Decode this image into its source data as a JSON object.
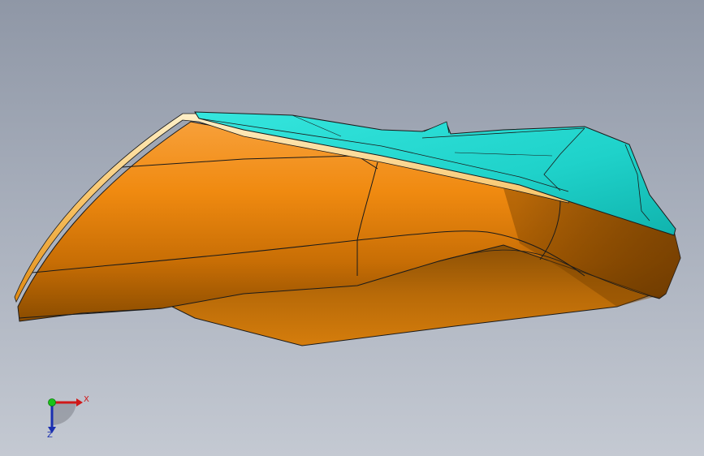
{
  "viewport": {
    "background_top": "#8f97a6",
    "background_bottom": "#c4c9d2"
  },
  "model": {
    "hull_color": "#f08a10",
    "hull_shadow_color": "#7a4300",
    "deck_color": "#1fd8d0",
    "deck_shadow_color": "#0fa9a4",
    "edge_color": "#1a1a1a"
  },
  "triad": {
    "x_label": "X",
    "z_label": "Z",
    "x_color": "#d01818",
    "y_color": "#18c418",
    "z_color": "#1a2fb0"
  }
}
